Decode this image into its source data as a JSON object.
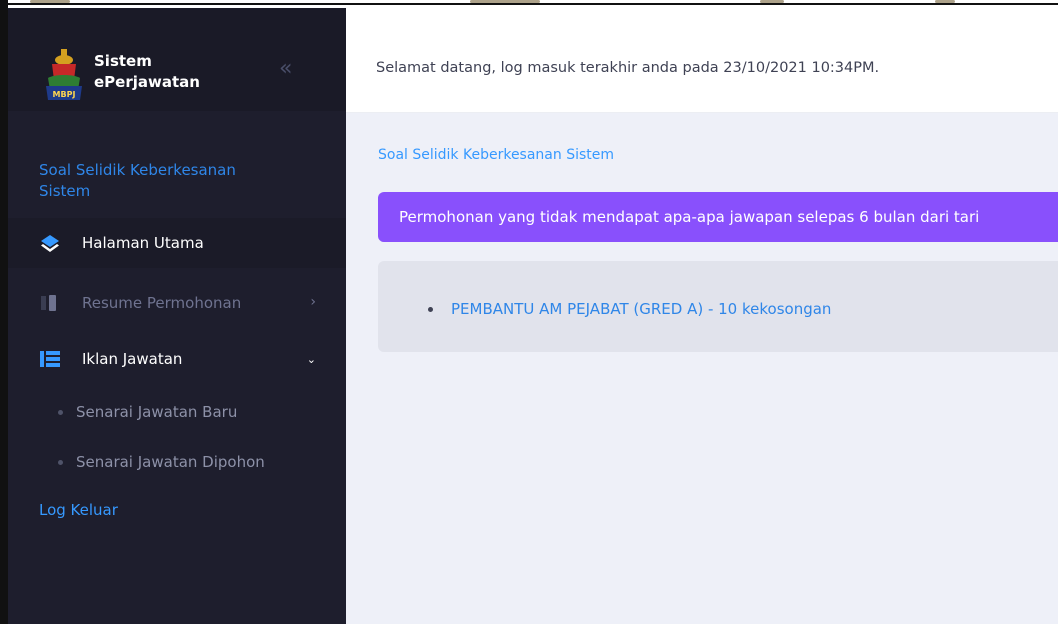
{
  "app": {
    "name_line1": "Sistem",
    "name_line2": "ePerjawatan",
    "logo_text": "MBPJ",
    "collapse_glyph": "«"
  },
  "sidebar": {
    "survey_link": "Soal Selidik Keberkesanan Sistem",
    "items": [
      {
        "label": "Halaman Utama",
        "icon": "layers-icon",
        "state": "active"
      },
      {
        "label": "Resume Permohonan",
        "icon": "resume-icon",
        "arrow": "›",
        "state": "collapsed"
      },
      {
        "label": "Iklan Jawatan",
        "icon": "list-icon",
        "arrow": "⌄",
        "state": "expanded"
      }
    ],
    "sub_items": [
      {
        "label": "Senarai Jawatan Baru"
      },
      {
        "label": "Senarai Jawatan Dipohon"
      }
    ],
    "logout": "Log Keluar"
  },
  "header": {
    "welcome": "Selamat datang, log masuk terakhir anda pada 23/10/2021 10:34PM."
  },
  "main": {
    "breadcrumb": "Soal Selidik Keberkesanan Sistem",
    "notice": "Permohonan yang tidak mendapat apa-apa jawapan selepas 6 bulan dari tari",
    "jobs": [
      {
        "label": "PEMBANTU AM PEJABAT (GRED A) - 10 kekosongan"
      }
    ]
  },
  "colors": {
    "sidebar_bg": "#1e1e2d",
    "link": "#3699ff",
    "notice_bg": "#8950fc",
    "content_bg": "#eef0f8"
  }
}
